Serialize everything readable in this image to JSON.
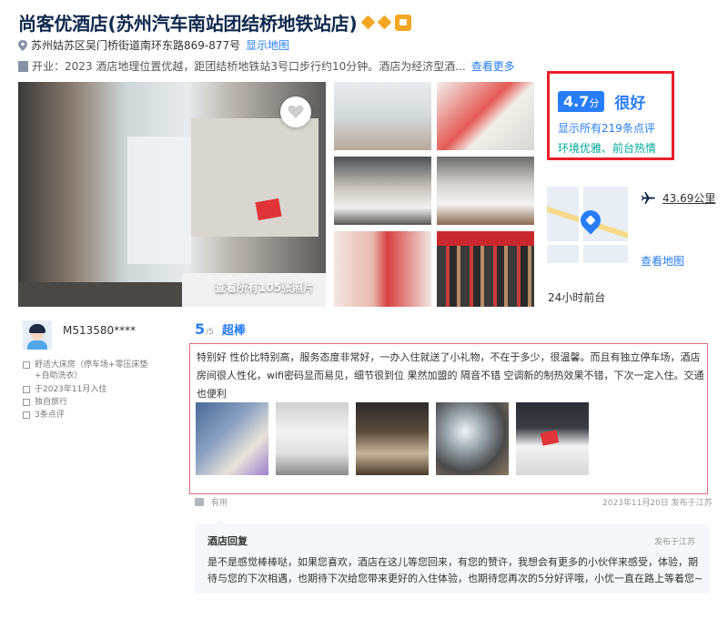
{
  "hotel": {
    "title": "尚客优酒店(苏州汽车南站团结桥地铁站店)",
    "address": "苏州姑苏区吴门桥街道南环东路869-877号",
    "show_map": "显示地图",
    "intro": "开业：2023  酒店地理位置优越，距团结桥地铁站3号口步行约10分钟。酒店为经济型酒...",
    "more": "查看更多",
    "all_photos": "查看所有105张照片"
  },
  "score": {
    "value": "4.7",
    "unit": "分",
    "label": "很好",
    "review_count": "显示所有219条点评",
    "tags": "环境优雅、前台热情"
  },
  "location": {
    "airport_distance": "43.69公里",
    "view_map": "查看地图",
    "front_desk": "24小时前台"
  },
  "review": {
    "username": "M513580****",
    "room_type": "舒适大床房（停车场+零压床垫+自助洗衣）",
    "checkin": "于2023年11月入住",
    "trip_type": "独自旅行",
    "review_count": "3条点评",
    "rating": "5",
    "rating_den": "/5",
    "rating_word": "超棒",
    "text": "特别好 性价比特别高，服务态度非常好，一办入住就送了小礼物，不在于多少，很温馨。而且有独立停车场，酒店房间很人性化，wifi密码显而易见，细节很到位 果然加盟的 隔音不错 空调新的制热效果不错，下次一定入住。交通也便利",
    "helpful": "有用",
    "date": "2023年11月20日 发布于江苏"
  },
  "reply": {
    "title": "酒店回复",
    "source": "发布于江苏",
    "text": "是不是感觉棒棒哒，如果您喜欢，酒店在这儿等您回来，有您的赞许，我想会有更多的小伙伴来感受，体验，期待与您的下次相遇，也期待下次给您带来更好的入住体验，也期待您再次的5分好评哦，小优一直在路上等着您~"
  },
  "colors": {
    "accent": "#287dfa",
    "highlight_border": "#e8202a",
    "tag_green": "#00a998",
    "title": "#0f294d"
  }
}
